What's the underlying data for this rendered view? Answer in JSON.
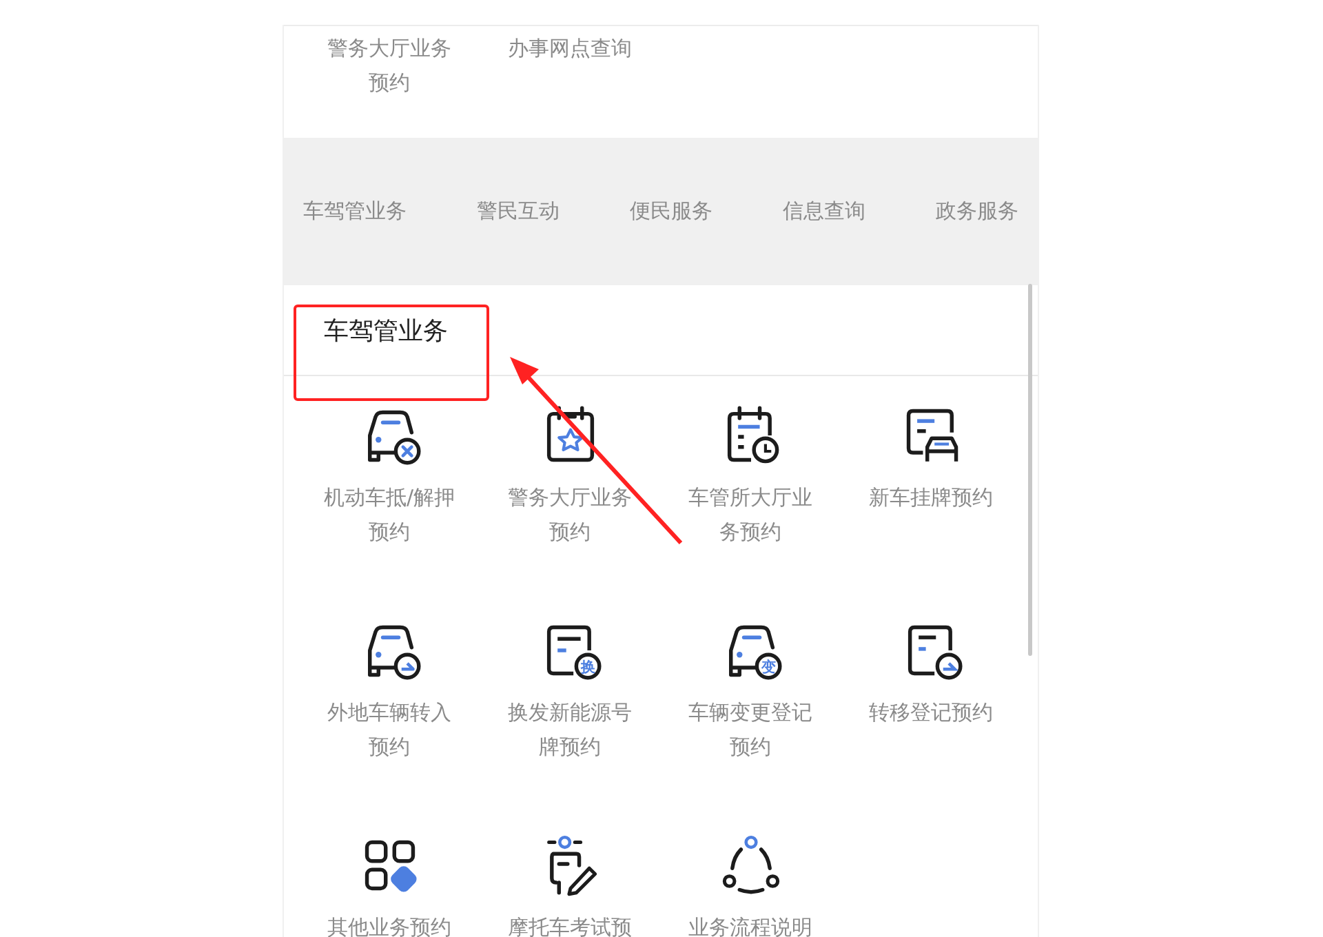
{
  "top_items": [
    "警务大厅业务预约",
    "办事网点查询"
  ],
  "tabs": [
    "车驾管业务",
    "警民互动",
    "便民服务",
    "信息查询",
    "政务服务"
  ],
  "section_title": "车驾管业务",
  "services": [
    {
      "kind": "car-cross",
      "label": "机动车抵/解押预约"
    },
    {
      "kind": "calendar-star",
      "label": "警务大厅业务预约"
    },
    {
      "kind": "calendar-clock",
      "label": "车管所大厅业务预约"
    },
    {
      "kind": "doc-car",
      "label": "新车挂牌预约"
    },
    {
      "kind": "car-swap",
      "label": "外地车辆转入预约"
    },
    {
      "kind": "doc-badge",
      "badge": "换",
      "label": "换发新能源号牌预约"
    },
    {
      "kind": "car-badge",
      "badge": "变",
      "label": "车辆变更登记预约"
    },
    {
      "kind": "doc-swap",
      "label": "转移登记预约"
    },
    {
      "kind": "grid",
      "label": "其他业务预约"
    },
    {
      "kind": "rider-pen",
      "label": "摩托车考试预"
    },
    {
      "kind": "flow",
      "label": "业务流程说明"
    }
  ]
}
